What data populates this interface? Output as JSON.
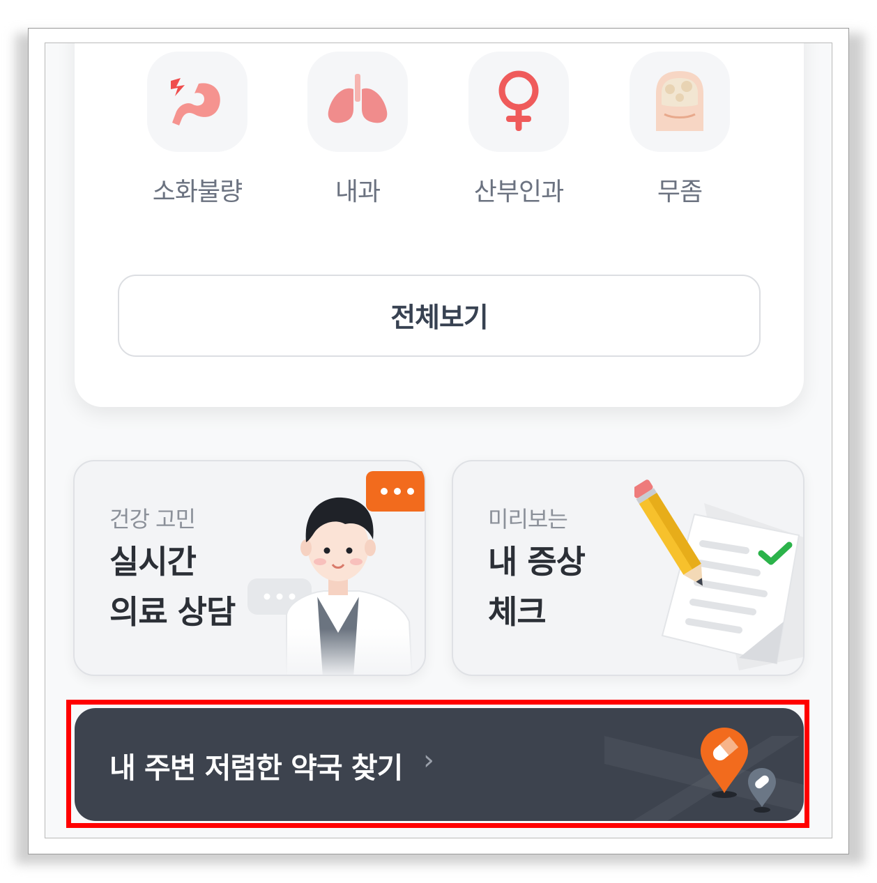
{
  "categories": [
    {
      "label": "소화불량",
      "icon": "stomach-icon"
    },
    {
      "label": "내과",
      "icon": "lungs-icon"
    },
    {
      "label": "산부인과",
      "icon": "female-symbol-icon"
    },
    {
      "label": "무좀",
      "icon": "toenail-icon"
    }
  ],
  "view_all_label": "전체보기",
  "feature_cards": [
    {
      "subtitle": "건강 고민",
      "title_line1": "실시간",
      "title_line2": "의료 상담",
      "icon": "doctor-chat-illustration"
    },
    {
      "subtitle": "미리보는",
      "title_line1": "내 증상",
      "title_line2": "체크",
      "icon": "pencil-checklist-illustration"
    }
  ],
  "banner": {
    "label": "내 주변 저렴한 약국 찾기",
    "chevron": "›",
    "icon": "map-pin-pill-icon"
  },
  "colors": {
    "accent_orange": "#f26b1d",
    "banner_bg": "#3d434e",
    "highlight": "#ff0000",
    "icon_pink": "#f08c8c"
  }
}
